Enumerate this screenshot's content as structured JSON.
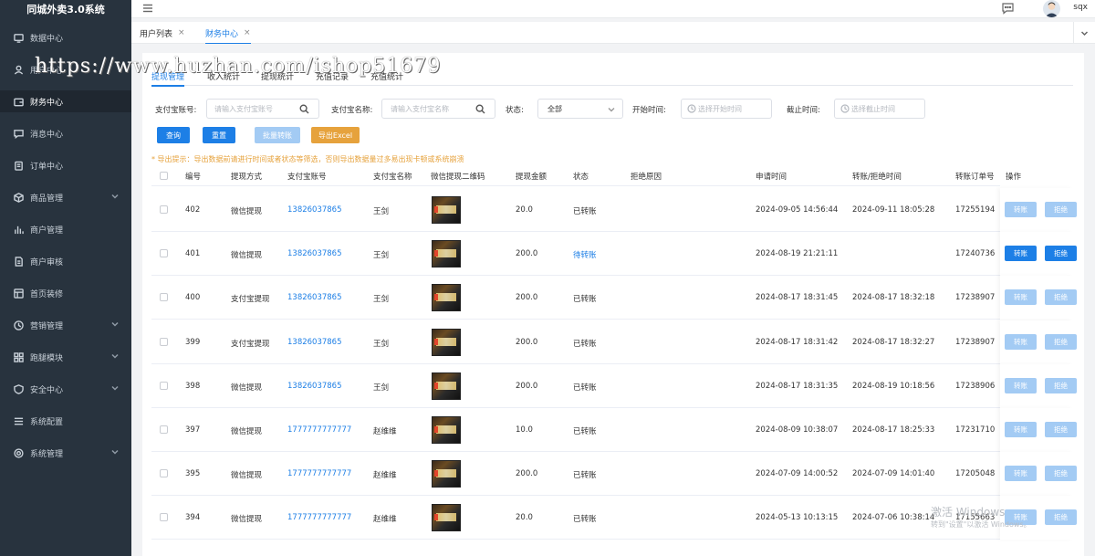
{
  "app": {
    "title": "同城外卖3.0系统"
  },
  "sidebar": {
    "items": [
      {
        "label": "数据中心",
        "icon": "monitor-icon",
        "caret": false
      },
      {
        "label": "用户中心",
        "icon": "user-icon",
        "caret": false
      },
      {
        "label": "财务中心",
        "icon": "wallet-icon",
        "caret": false,
        "active": true
      },
      {
        "label": "消息中心",
        "icon": "message-icon",
        "caret": false
      },
      {
        "label": "订单中心",
        "icon": "order-icon",
        "caret": false
      },
      {
        "label": "商品管理",
        "icon": "box-icon",
        "caret": true
      },
      {
        "label": "商户管理",
        "icon": "chart-icon",
        "caret": false
      },
      {
        "label": "商户审核",
        "icon": "document-icon",
        "caret": false
      },
      {
        "label": "首页装修",
        "icon": "layout-icon",
        "caret": false
      },
      {
        "label": "营销管理",
        "icon": "clock-icon",
        "caret": true
      },
      {
        "label": "跑腿模块",
        "icon": "grid-icon",
        "caret": true
      },
      {
        "label": "安全中心",
        "icon": "shield-icon",
        "caret": true
      },
      {
        "label": "系统配置",
        "icon": "list-icon",
        "caret": false
      },
      {
        "label": "系统管理",
        "icon": "settings-icon",
        "caret": true
      }
    ]
  },
  "header": {
    "username": "sqx"
  },
  "watermark": {
    "text": "https://www.huzhan.com/ishop51679"
  },
  "page_tabs": [
    {
      "label": "用户列表",
      "close": "×",
      "active": false
    },
    {
      "label": "财务中心",
      "close": "×",
      "active": true
    }
  ],
  "sub_tabs": [
    {
      "label": "提现管理",
      "active": true
    },
    {
      "label": "收入统计",
      "active": false
    },
    {
      "label": "提现统计",
      "active": false
    },
    {
      "label": "充值记录",
      "active": false
    },
    {
      "label": "充值统计",
      "active": false
    }
  ],
  "filters": {
    "alipay_account_label": "支付宝账号:",
    "alipay_account_placeholder": "请输入支付宝账号",
    "alipay_name_label": "支付宝名称:",
    "alipay_name_placeholder": "请输入支付宝名称",
    "status_label": "状态:",
    "status_value": "全部",
    "start_label": "开始时间:",
    "start_placeholder": "选择开始时间",
    "end_label": "截止时间:",
    "end_placeholder": "选择截止时间"
  },
  "buttons": {
    "query": "查询",
    "reset": "重置",
    "batch_transfer": "批量转账",
    "export": "导出Excel"
  },
  "hint": "* 导出提示：导出数据前请进行时间或者状态等筛选，否则导出数据量过多易出现卡顿或系统崩溃",
  "table": {
    "columns": [
      "编号",
      "提现方式",
      "支付宝账号",
      "支付宝名称",
      "微信提现二维码",
      "提现金额",
      "状态",
      "拒绝原因",
      "申请时间",
      "转账/拒绝时间",
      "转账订单号",
      "操作"
    ],
    "rows": [
      {
        "id": "402",
        "method": "微信提现",
        "account": "13826037865",
        "name": "王剑",
        "amount": "20.0",
        "status": "已转账",
        "status_type": "done",
        "reason": "",
        "apply": "2024-09-05 14:56:44",
        "handled": "2024-09-11 18:05:28",
        "order": "17255194"
      },
      {
        "id": "401",
        "method": "微信提现",
        "account": "13826037865",
        "name": "王剑",
        "amount": "200.0",
        "status": "待转账",
        "status_type": "pending",
        "reason": "",
        "apply": "2024-08-19 21:21:11",
        "handled": "",
        "order": "17240736"
      },
      {
        "id": "400",
        "method": "支付宝提现",
        "account": "13826037865",
        "name": "王剑",
        "amount": "200.0",
        "status": "已转账",
        "status_type": "done",
        "reason": "",
        "apply": "2024-08-17 18:31:45",
        "handled": "2024-08-17 18:32:18",
        "order": "17238907"
      },
      {
        "id": "399",
        "method": "支付宝提现",
        "account": "13826037865",
        "name": "王剑",
        "amount": "200.0",
        "status": "已转账",
        "status_type": "done",
        "reason": "",
        "apply": "2024-08-17 18:31:42",
        "handled": "2024-08-17 18:32:27",
        "order": "17238907"
      },
      {
        "id": "398",
        "method": "微信提现",
        "account": "13826037865",
        "name": "王剑",
        "amount": "200.0",
        "status": "已转账",
        "status_type": "done",
        "reason": "",
        "apply": "2024-08-17 18:31:35",
        "handled": "2024-08-19 10:18:56",
        "order": "17238906"
      },
      {
        "id": "397",
        "method": "微信提现",
        "account": "1777777777777",
        "name": "赵维维",
        "amount": "10.0",
        "status": "已转账",
        "status_type": "done",
        "reason": "",
        "apply": "2024-08-09 10:38:07",
        "handled": "2024-08-17 18:25:33",
        "order": "17231710"
      },
      {
        "id": "395",
        "method": "微信提现",
        "account": "1777777777777",
        "name": "赵维维",
        "amount": "200.0",
        "status": "已转账",
        "status_type": "done",
        "reason": "",
        "apply": "2024-07-09 14:00:52",
        "handled": "2024-07-09 14:01:40",
        "order": "17205048"
      },
      {
        "id": "394",
        "method": "微信提现",
        "account": "1777777777777",
        "name": "赵维维",
        "amount": "20.0",
        "status": "已转账",
        "status_type": "done",
        "reason": "",
        "apply": "2024-05-13 10:13:15",
        "handled": "2024-07-06 10:38:14",
        "order": "17155663"
      }
    ],
    "op_transfer": "转账",
    "op_reject": "拒绝"
  },
  "windows_watermark": {
    "line1": "激活 Windows",
    "line2": "转到\"设置\"以激活 Windows。"
  }
}
